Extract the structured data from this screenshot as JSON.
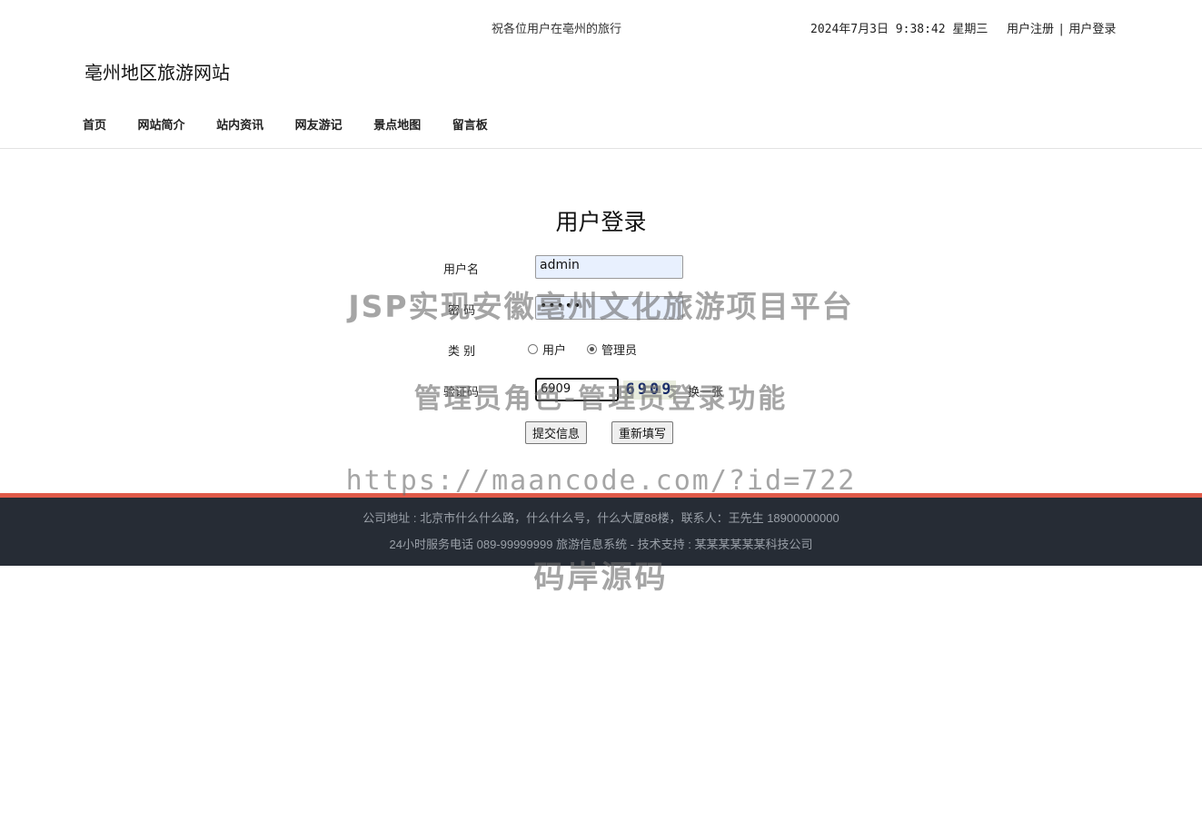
{
  "header": {
    "greeting": "祝各位用户在亳州的旅行",
    "datetime": "2024年7月3日 9:38:42 星期三",
    "register_link": "用户注册",
    "separator": "|",
    "login_link": "用户登录",
    "site_title": "亳州地区旅游网站"
  },
  "nav": {
    "items": [
      "首页",
      "网站简介",
      "站内资讯",
      "网友游记",
      "景点地图",
      "留言板"
    ]
  },
  "login": {
    "title": "用户登录",
    "username_label": "用户名",
    "username_value": "admin",
    "password_label": "密 码",
    "password_value": "•••••",
    "type_label": "类 别",
    "type_options": [
      "用户",
      "管理员"
    ],
    "type_selected": "管理员",
    "captcha_label": "验证码",
    "captcha_value": "6909",
    "captcha_image_text": "6909",
    "captcha_refresh": "换一张",
    "submit_button": "提交信息",
    "reset_button": "重新填写"
  },
  "footer": {
    "address_line": "公司地址 : 北京市什么什么路，什么什么号，什么大厦88楼，联系人：王先生 18900000000",
    "service_line": "24小时服务电话   089-99999999   旅游信息系统 - 技术支持 : 某某某某某某科技公司"
  },
  "watermark": {
    "line1": "JSP实现安徽亳州文化旅游项目平台",
    "line2": "管理员角色-管理员登录功能",
    "line3": "https://maancode.com/?id=722",
    "line4": "码岸源码"
  },
  "colors": {
    "footer_bg": "#262c35",
    "footer_accent": "#e05a49",
    "input_autofill": "#e8f0fe"
  }
}
